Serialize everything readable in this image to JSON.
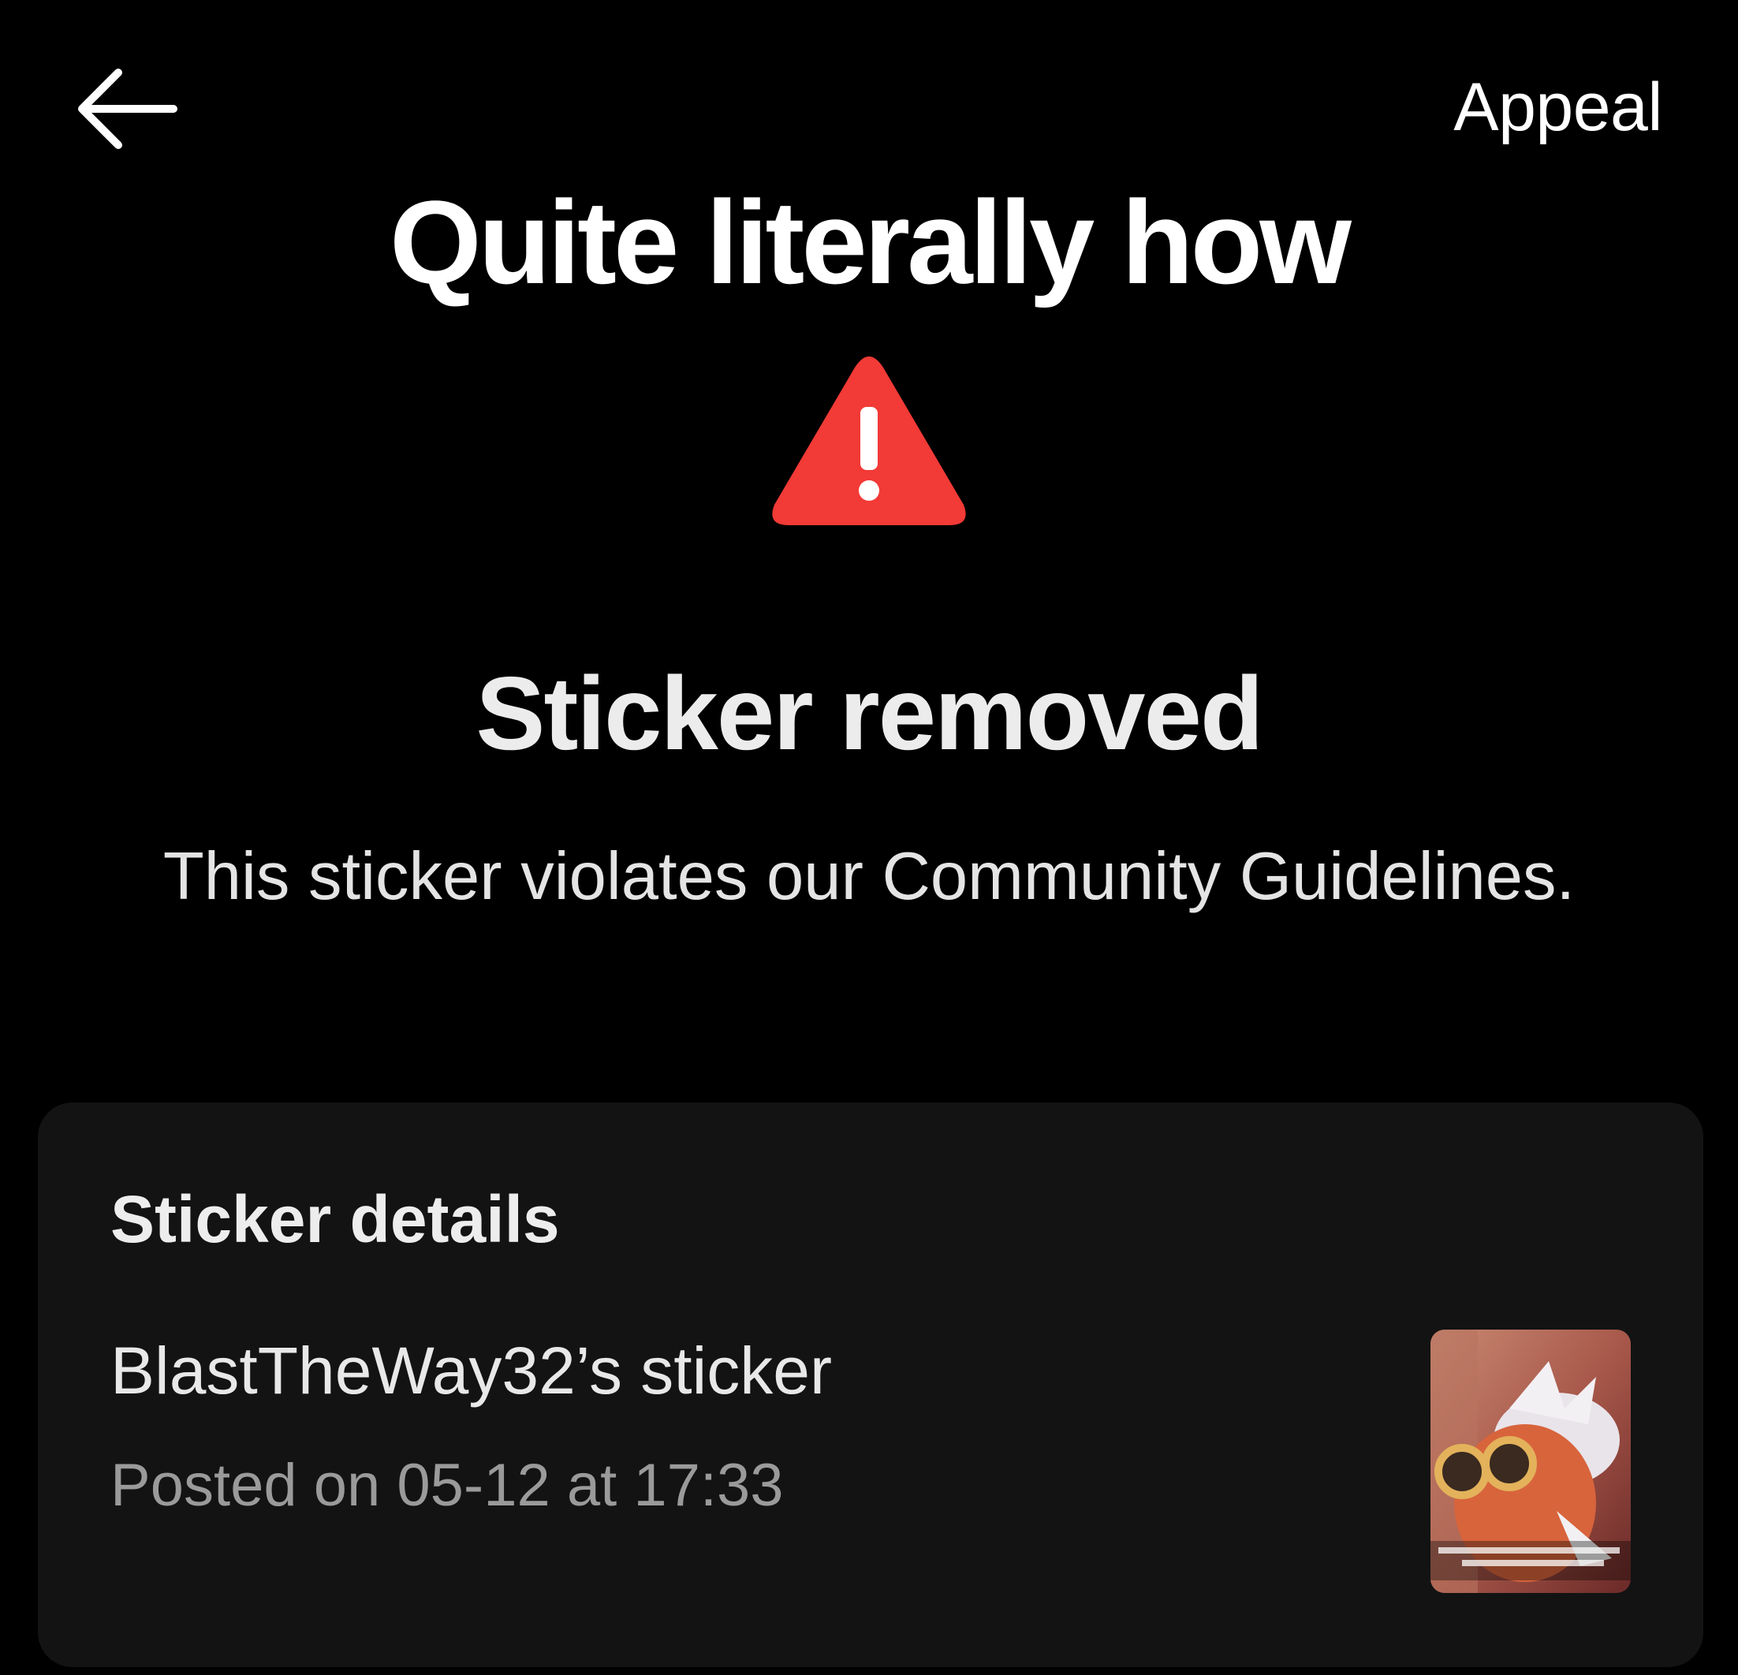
{
  "header": {
    "back_icon": "back-arrow-icon",
    "appeal_label": "Appeal"
  },
  "overlay": {
    "title": "Quite literally how"
  },
  "status": {
    "icon": "warning-triangle-icon",
    "icon_color": "#f23a36",
    "title": "Sticker removed",
    "description": "This sticker violates our Community Guidelines."
  },
  "details": {
    "heading": "Sticker details",
    "owner": "BlastTheWay32’s sticker",
    "posted": "Posted on 05-12 at 17:33"
  },
  "colors": {
    "background": "#000000",
    "card": "#131313",
    "secondary_text": "#9a9a9a"
  }
}
